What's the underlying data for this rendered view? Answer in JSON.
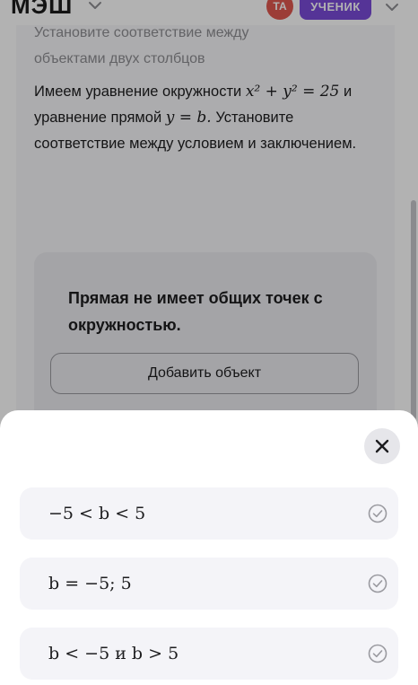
{
  "header": {
    "logo": "МЭШ",
    "avatar_initials": "ТА",
    "role_label": "УЧЕНИК"
  },
  "task": {
    "heading_partial": "Установите соответствие между",
    "heading_rest": "объектами двух столбцов",
    "text_1": "Имеем уравнение окружности",
    "circle_equation": "x² + y² = 25",
    "text_2": "и уравнение прямой",
    "line_equation": "y = b.",
    "text_3": "Установите соответствие между условием и заключением."
  },
  "drop_zone": {
    "condition": "Прямая не имеет общих точек с окружностью.",
    "add_button_label": "Добавить объект"
  },
  "sheet": {
    "options": [
      {
        "label": "−5 < b < 5"
      },
      {
        "label": "b = −5; 5"
      },
      {
        "label": "b < −5 и b > 5"
      }
    ]
  },
  "colors": {
    "accent": "#7a4bd8",
    "avatar": "#e0584f",
    "sheet_option_bg": "#f4f4f8"
  }
}
